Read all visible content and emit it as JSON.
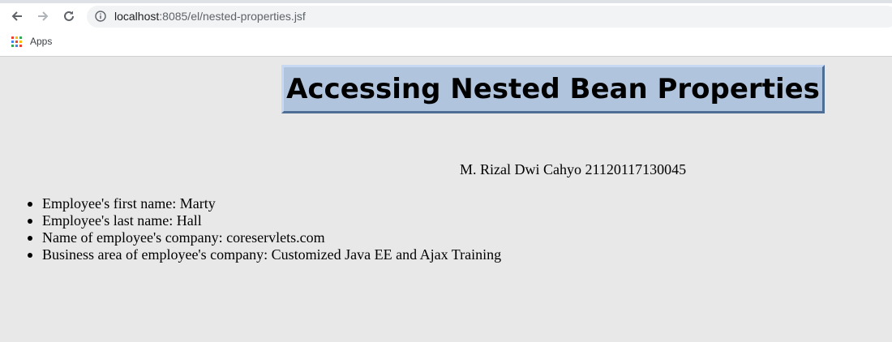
{
  "browser": {
    "url_host": "localhost",
    "url_rest": ":8085/el/nested-properties.jsf",
    "bookmarks": {
      "apps_label": "Apps"
    }
  },
  "page": {
    "title": "Accessing Nested Bean Properties",
    "author": "M. Rizal Dwi Cahyo 21120117130045",
    "employee_items": [
      "Employee's first name: Marty",
      "Employee's last name: Hall",
      "Name of employee's company: coreservlets.com",
      "Business area of employee's company: Customized Java EE and Ajax Training"
    ]
  },
  "colors": {
    "page_background": "#e8e8e8",
    "title_box": "#b0c4de",
    "apps_grid": [
      "#ea4335",
      "#fbbc05",
      "#34a853",
      "#4285f4",
      "#ea4335",
      "#fbbc05",
      "#34a853",
      "#4285f4",
      "#ea4335"
    ]
  }
}
